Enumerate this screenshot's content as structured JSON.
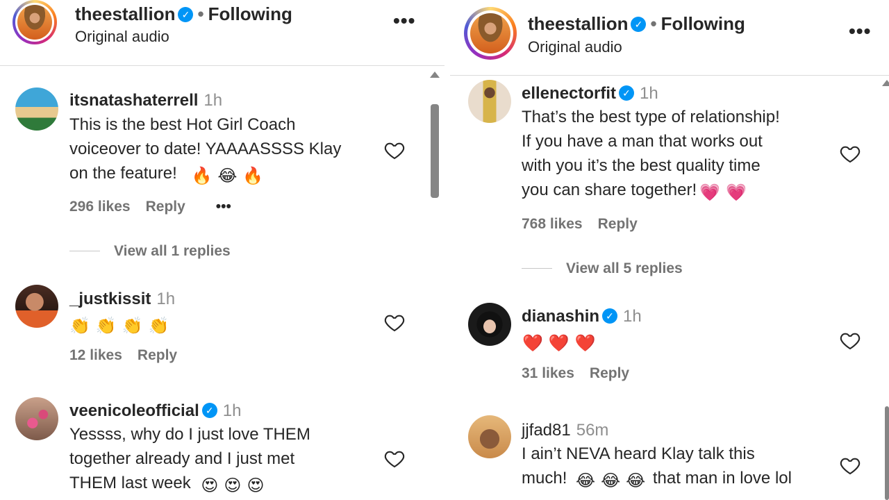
{
  "left": {
    "header": {
      "username": "theestallion",
      "verified": "✓",
      "dot": "•",
      "following": "Following",
      "audio": "Original audio",
      "more": "•••"
    },
    "comments": [
      {
        "user": "itsnatashaterrell",
        "time": "1h",
        "lines": [
          "This is the best Hot Girl Coach",
          "voiceover to date! YAAAASSSS Klay",
          "on the feature!"
        ],
        "emoji": [
          "🔥",
          "😂",
          "🔥"
        ],
        "likes": "296 likes",
        "reply": "Reply",
        "more": "•••",
        "view_replies": "View all 1 replies"
      },
      {
        "user": "_justkissit",
        "time": "1h",
        "lines": [
          ""
        ],
        "emoji": [
          "👏",
          "👏",
          "👏",
          "👏"
        ],
        "likes": "12 likes",
        "reply": "Reply"
      },
      {
        "user": "veenicoleofficial",
        "verified": "✓",
        "time": "1h",
        "lines": [
          "Yessss, why do I just love THEM",
          "together already and I just met",
          "THEM last week"
        ],
        "emoji": [
          "😍",
          "😍",
          "😍"
        ]
      }
    ]
  },
  "right": {
    "header": {
      "username": "theestallion",
      "verified": "✓",
      "dot": "•",
      "following": "Following",
      "audio": "Original audio",
      "more": "•••"
    },
    "comments": [
      {
        "user": "ellenectorfit",
        "verified": "✓",
        "time": "1h",
        "lines": [
          "That’s the best type of relationship!",
          "If you have a man that works out",
          "with you it’s the best quality time",
          "you can share together!"
        ],
        "emoji": [
          "💗",
          "💗"
        ],
        "likes": "768 likes",
        "reply": "Reply",
        "view_replies": "View all 5 replies"
      },
      {
        "user": "dianashin",
        "verified": "✓",
        "time": "1h",
        "lines": [
          ""
        ],
        "emoji": [
          "❤️",
          "❤️",
          "❤️"
        ],
        "likes": "31 likes",
        "reply": "Reply"
      },
      {
        "user": "jjfad81",
        "time": "56m",
        "lines": [
          "I ain’t NEVA heard Klay talk this",
          "much!"
        ],
        "emoji": [
          "😂",
          "😂",
          "😂"
        ],
        "tail": "that man in love lol"
      }
    ]
  },
  "colors": {
    "verified": "#0095f6",
    "text": "#262626",
    "muted": "#737373",
    "time": "#8e8e8e"
  }
}
